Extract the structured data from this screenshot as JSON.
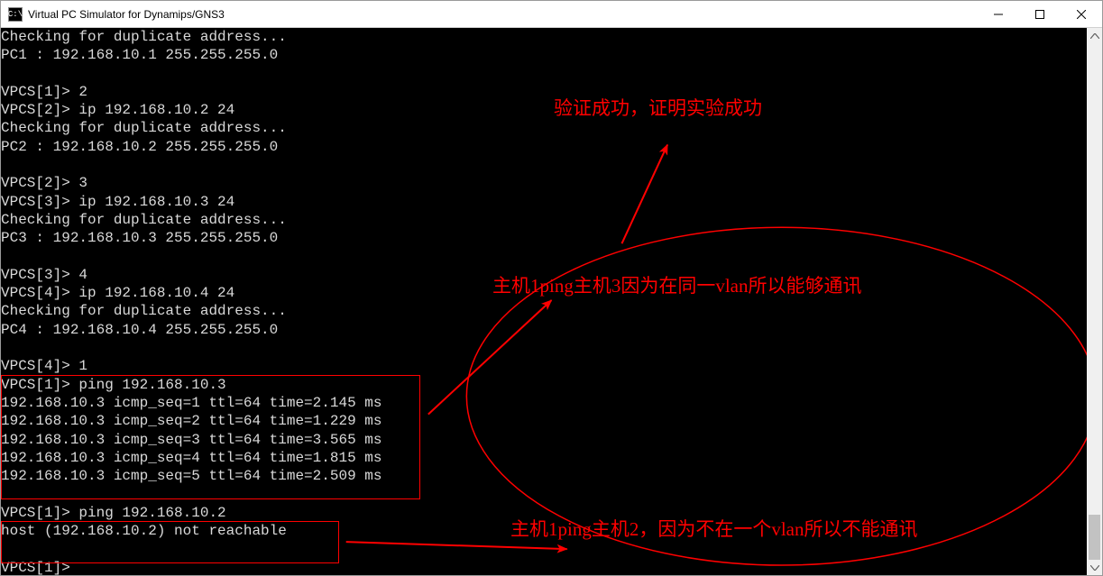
{
  "window": {
    "title": "Virtual PC Simulator for Dynamips/GNS3",
    "icon_glyph": "C:\\"
  },
  "controls": {
    "min_name": "minimize-icon",
    "max_name": "maximize-icon",
    "close_name": "close-icon"
  },
  "terminal": {
    "lines": [
      "Checking for duplicate address...",
      "PC1 : 192.168.10.1 255.255.255.0",
      "",
      "VPCS[1]> 2",
      "VPCS[2]> ip 192.168.10.2 24",
      "Checking for duplicate address...",
      "PC2 : 192.168.10.2 255.255.255.0",
      "",
      "VPCS[2]> 3",
      "VPCS[3]> ip 192.168.10.3 24",
      "Checking for duplicate address...",
      "PC3 : 192.168.10.3 255.255.255.0",
      "",
      "VPCS[3]> 4",
      "VPCS[4]> ip 192.168.10.4 24",
      "Checking for duplicate address...",
      "PC4 : 192.168.10.4 255.255.255.0",
      "",
      "VPCS[4]> 1",
      "VPCS[1]> ping 192.168.10.3",
      "192.168.10.3 icmp_seq=1 ttl=64 time=2.145 ms",
      "192.168.10.3 icmp_seq=2 ttl=64 time=1.229 ms",
      "192.168.10.3 icmp_seq=3 ttl=64 time=3.565 ms",
      "192.168.10.3 icmp_seq=4 ttl=64 time=1.815 ms",
      "192.168.10.3 icmp_seq=5 ttl=64 time=2.509 ms",
      "",
      "VPCS[1]> ping 192.168.10.2",
      "host (192.168.10.2) not reachable",
      "",
      "VPCS[1]>"
    ]
  },
  "annotations": {
    "top": "验证成功，证明实验成功",
    "middle": "主机1ping主机3因为在同一vlan所以能够通讯",
    "bottom": "主机1ping主机2，因为不在一个vlan所以不能通讯"
  }
}
